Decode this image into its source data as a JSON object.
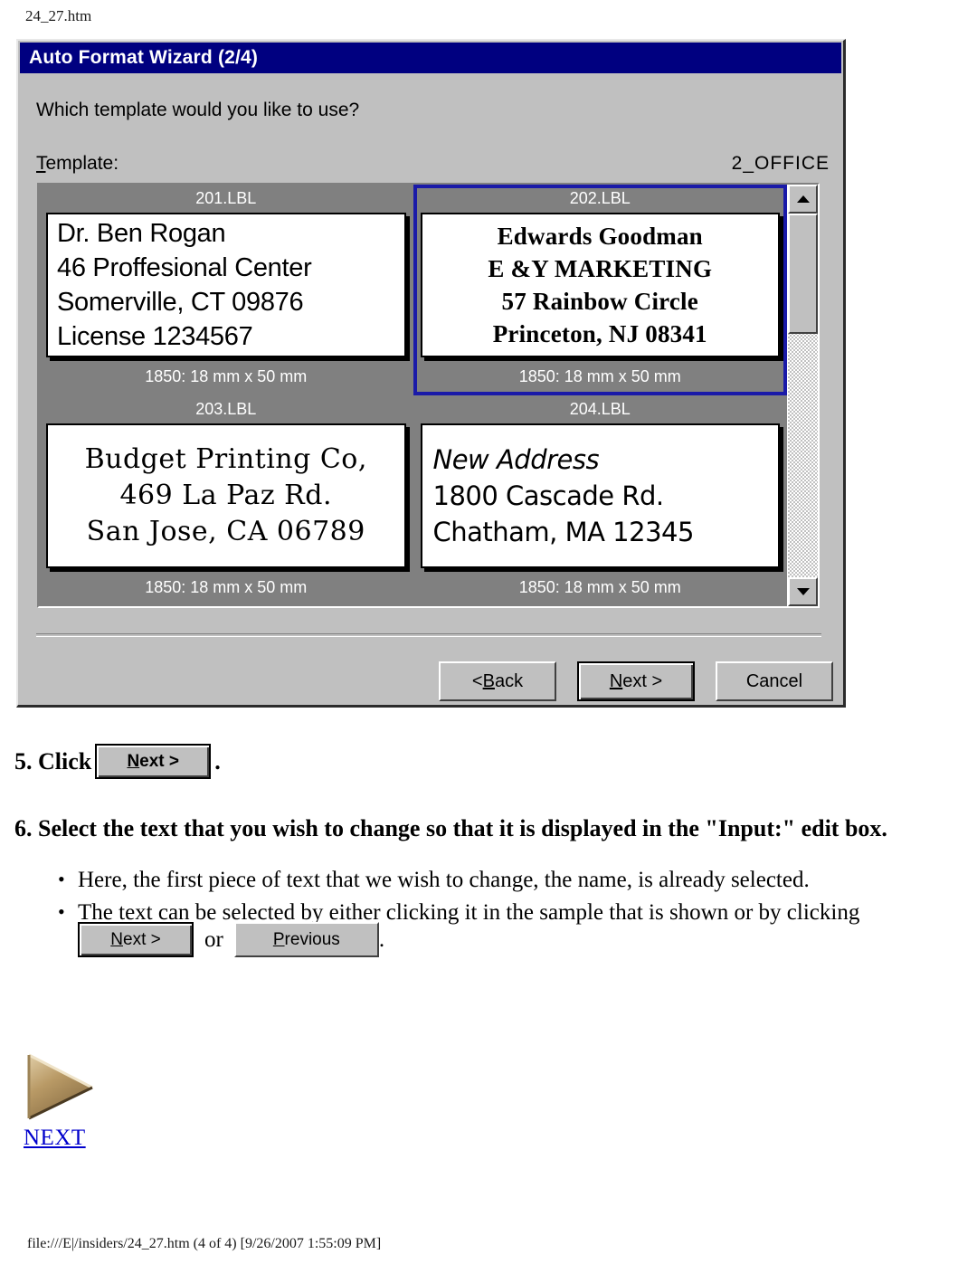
{
  "page": {
    "header_filename": "24_27.htm",
    "footer": "file:///E|/insiders/24_27.htm (4 of 4) [9/26/2007 1:55:09 PM]"
  },
  "dialog": {
    "title": "Auto Format Wizard (2/4)",
    "prompt": "Which template would you like to use?",
    "template_label": "Template:",
    "template_label_accel": "T",
    "template_label_rest": "emplate:",
    "template_name": "2_OFFICE",
    "buttons": [
      {
        "label": "< Back",
        "accel": "B",
        "pre": "< ",
        "post": "ack",
        "default": false
      },
      {
        "label": "Next >",
        "accel": "N",
        "pre": "",
        "post": "ext >",
        "default": true
      },
      {
        "label": "Cancel",
        "accel": "",
        "pre": "Cancel",
        "post": "",
        "default": false
      }
    ],
    "templates": [
      {
        "title": "201.LBL",
        "size": "1850: 18 mm x 50 mm",
        "selected": false,
        "style": "style-sans",
        "lines": [
          "Dr. Ben Rogan",
          "46 Proffesional Center",
          "Somerville, CT 09876",
          "License 1234567"
        ]
      },
      {
        "title": "202.LBL",
        "size": "1850: 18 mm x 50 mm",
        "selected": true,
        "style": "style-serif",
        "lines": [
          "Edwards Goodman",
          "E &Y MARKETING",
          "57 Rainbow Circle",
          "Princeton, NJ 08341"
        ]
      },
      {
        "title": "203.LBL",
        "size": "1850: 18 mm x 50 mm",
        "selected": false,
        "style": "style-deco",
        "lines": [
          "Budget Printing Co,",
          "469 La Paz Rd.",
          "San Jose, CA 06789"
        ]
      },
      {
        "title": "204.LBL",
        "size": "1850: 18 mm x 50 mm",
        "selected": false,
        "style": "style-geo",
        "lines": [
          "New Address",
          "1800 Cascade Rd.",
          "Chatham, MA 12345"
        ]
      }
    ],
    "scrollbar": {
      "up_icon": "triangle-up-icon",
      "down_icon": "triangle-down-icon"
    }
  },
  "instructions": {
    "step5_number": "5. Click",
    "step5_button": {
      "pre": "",
      "accel": "N",
      "post": "ext >"
    },
    "step5_period": ".",
    "step6": "6. Select the text that you wish to change so that it is displayed in the \"Input:\" edit box.",
    "bullets": [
      "Here, the first piece of text that we wish to change, the name, is already selected.",
      "The text can be selected by either clicking it in the sample that is shown or by clicking"
    ],
    "bullet_glyph": "•",
    "inline_next": {
      "pre": "",
      "accel": "N",
      "post": "ext >"
    },
    "inline_or": "or",
    "inline_previous": {
      "pre": "",
      "accel": "P",
      "post": "revious"
    },
    "inline_period": "."
  },
  "next_nav": {
    "label": "NEXT",
    "icon": "triangle-right-arrow-icon",
    "link_color": "#0000cc",
    "arrow_colors": {
      "light": "#d9c39a",
      "mid": "#b99a66",
      "dark": "#6b5434"
    }
  }
}
